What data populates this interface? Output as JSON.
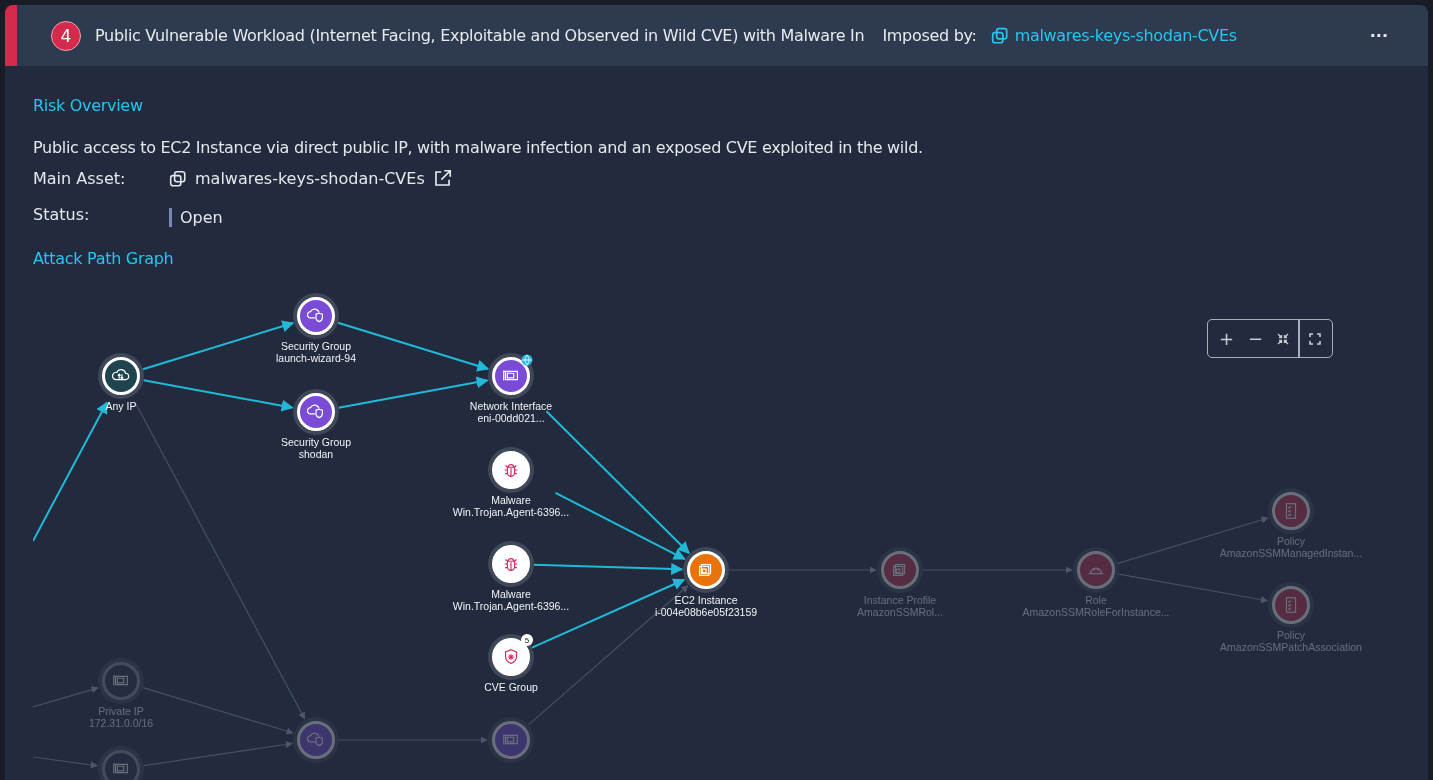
{
  "finding": {
    "number": "4",
    "title": "Public Vulnerable Workload (Internet Facing, Exploitable and Observed in Wild CVE) with Malware In",
    "imposed_label": "Imposed by:",
    "imposed_by": "malwares-keys-shodan-CVEs",
    "menu": "···"
  },
  "risk_overview": {
    "heading": "Risk Overview",
    "description": "Public access to EC2 Instance via direct public IP, with malware infection and an exposed CVE exploited in the wild.",
    "main_asset_label": "Main Asset:",
    "main_asset": "malwares-keys-shodan-CVEs",
    "status_label": "Status:",
    "status": "Open"
  },
  "attack_path": {
    "heading": "Attack Path Graph",
    "nodes": [
      {
        "kind": "any-ip",
        "type": "Any IP",
        "dimmed": false
      },
      {
        "kind": "security-group",
        "type": "Security Group",
        "name": "launch-wizard-94",
        "dimmed": false
      },
      {
        "kind": "security-group",
        "type": "Security Group",
        "name": "shodan",
        "dimmed": false
      },
      {
        "kind": "network-interface",
        "type": "Network Interface",
        "name": "eni-00dd021...",
        "dimmed": false,
        "public": true
      },
      {
        "kind": "malware",
        "type": "Malware",
        "name": "Win.Trojan.Agent-6396...",
        "dimmed": false
      },
      {
        "kind": "malware",
        "type": "Malware",
        "name": "Win.Trojan.Agent-6396...",
        "dimmed": false
      },
      {
        "kind": "cve-group",
        "type": "CVE Group",
        "badge": "5",
        "dimmed": false
      },
      {
        "kind": "ec2",
        "type": "EC2 Instance",
        "name": "i-004e08b6e05f23159",
        "dimmed": false
      },
      {
        "kind": "instance-profile",
        "type": "Instance Profile",
        "name": "AmazonSSMRol...",
        "dimmed": true
      },
      {
        "kind": "role",
        "type": "Role",
        "name": "AmazonSSMRoleForInstance...",
        "dimmed": true
      },
      {
        "kind": "policy",
        "type": "Policy",
        "name": "AmazonSSMManagedInstan...",
        "dimmed": true
      },
      {
        "kind": "policy",
        "type": "Policy",
        "name": "AmazonSSMPatchAssociation",
        "dimmed": true
      },
      {
        "kind": "private-ip",
        "type": "Private IP",
        "name": "172.31.0.0/16",
        "dimmed": true
      },
      {
        "kind": "security-group",
        "dimmed": true
      },
      {
        "kind": "network-interface",
        "dimmed": true
      },
      {
        "kind": "private-ip",
        "dimmed": true
      }
    ],
    "zoom_controls": [
      "+",
      "−"
    ]
  }
}
